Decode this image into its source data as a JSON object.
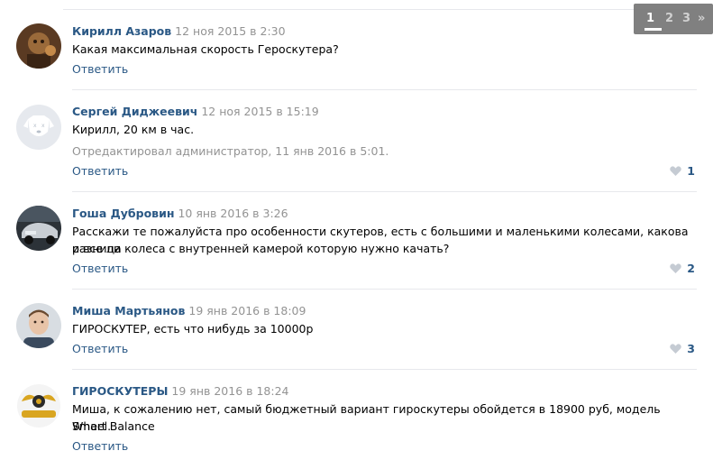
{
  "pager": {
    "pages": [
      "1",
      "2",
      "3"
    ],
    "next": "»",
    "active": "1"
  },
  "reply_label": "Ответить",
  "comments": [
    {
      "author": "Кирилл Азаров",
      "date": "12 ноя 2015 в 2:30",
      "text": "Какая максимальная скорость Героскутера?",
      "avatar": "brown-figure-avatar"
    },
    {
      "author": "Сергей Диджеевич",
      "date": "12 ноя 2015 в 15:19",
      "text": "Кирилл, 20 км в час.",
      "edited": "Отредактировал администратор, 11 янв 2016 в 5:01.",
      "likes": "1",
      "avatar": "deactivated-dog-avatar"
    },
    {
      "author": "Гоша Дубровин",
      "date": "10 янв 2016 в 3:26",
      "text_line1": "Расскажи те пожалуйста про особенности скутеров, есть с большими и маленькими колесами, какова разница",
      "text_line2": "и все ли колеса с внутренней камерой которую нужно качать?",
      "likes": "2",
      "avatar": "car-avatar"
    },
    {
      "author": "Миша Мартьянов",
      "date": "19 янв 2016 в 18:09",
      "text": "ГИРОСКУТЕР, есть что нибудь за 10000р",
      "likes": "3",
      "avatar": "young-man-avatar"
    },
    {
      "author": "ГИРОСКУТЕРЫ",
      "date": "19 янв 2016 в 18:24",
      "text_line1": "Миша, к сожалению нет, самый бюджетный вариант гироскутеры обойдется в 18900 руб, модель Smart Balance",
      "text_line2": "Wheel.",
      "avatar": "gyro-logo-avatar"
    }
  ],
  "colors": {
    "link": "#2a5885",
    "meta": "#939393",
    "separator": "#e7e8ec"
  }
}
